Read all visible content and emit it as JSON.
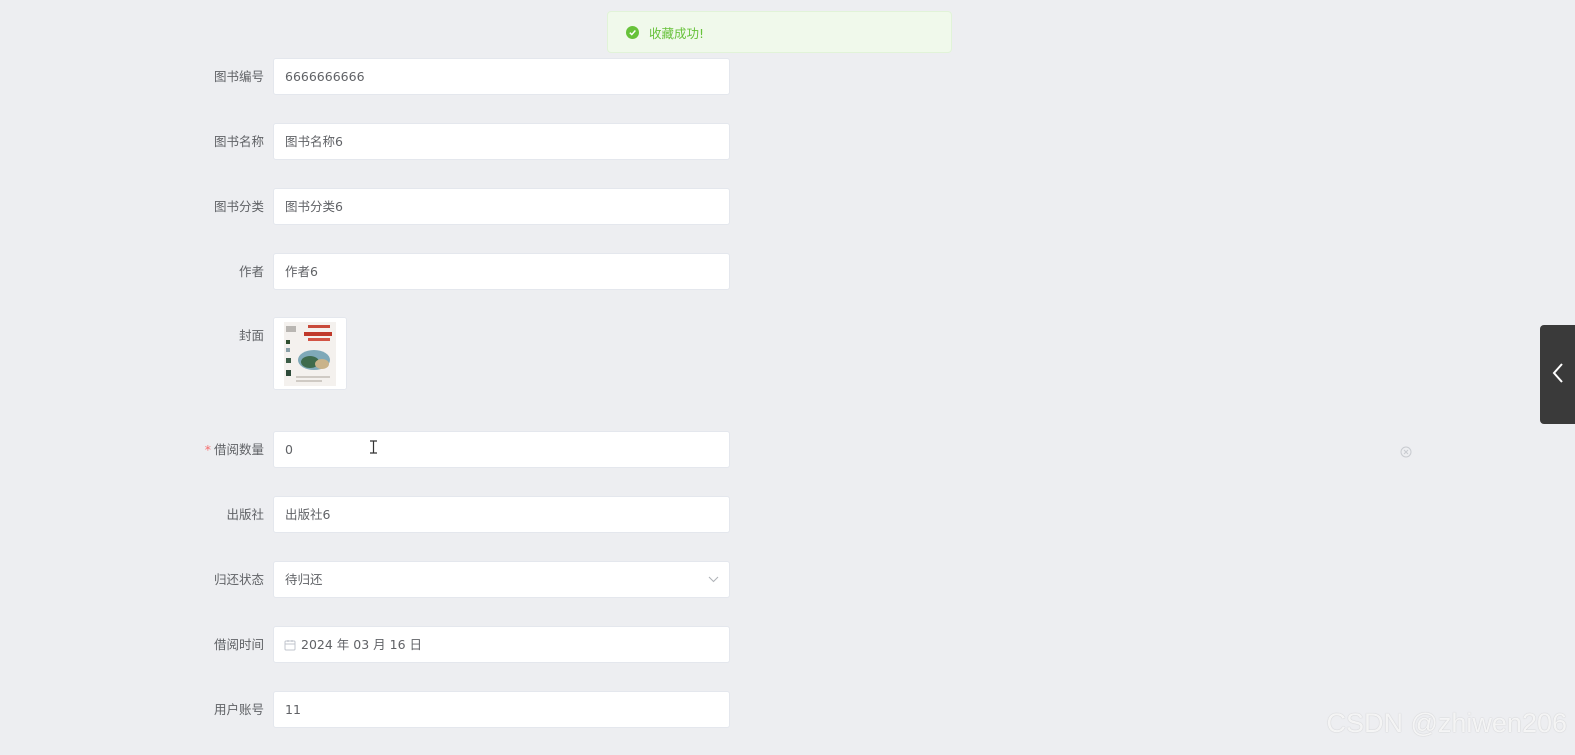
{
  "toast": {
    "message": "收藏成功!",
    "color": "#67c23a"
  },
  "form": {
    "book_no": {
      "label": "图书编号",
      "value": "6666666666"
    },
    "book_name": {
      "label": "图书名称",
      "value": "图书名称6"
    },
    "book_category": {
      "label": "图书分类",
      "value": "图书分类6"
    },
    "author": {
      "label": "作者",
      "value": "作者6"
    },
    "cover": {
      "label": "封面"
    },
    "borrow_qty": {
      "label": "借阅数量",
      "required_mark": "*",
      "value": "0"
    },
    "publisher": {
      "label": "出版社",
      "value": "出版社6"
    },
    "return_status": {
      "label": "归还状态",
      "value": "待归还"
    },
    "borrow_time": {
      "label": "借阅时间",
      "value": "2024 年 03 月 16 日"
    },
    "user_account": {
      "label": "用户账号",
      "value": "11"
    }
  },
  "icons": {
    "success": "check-circle-icon",
    "select": "chevron-down-icon",
    "date": "calendar-icon",
    "side_tab": "chevron-left-icon",
    "clear": "close-circle-icon"
  },
  "watermark": "CSDN @zhiwen206"
}
